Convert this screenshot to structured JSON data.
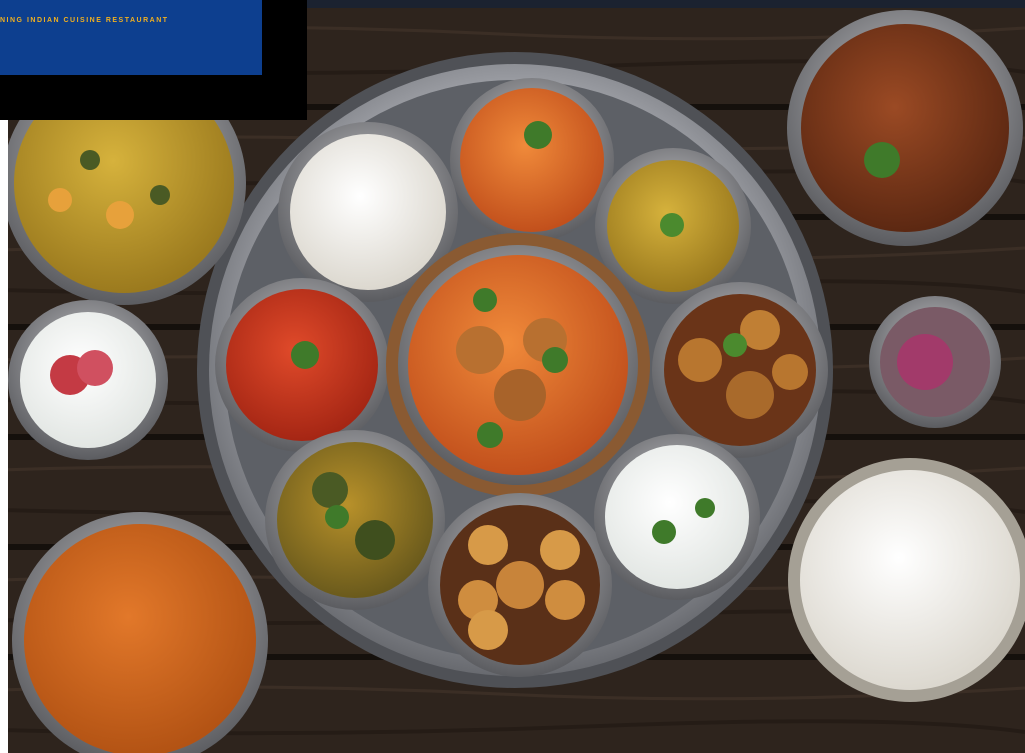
{
  "banner": {
    "text": "NING INDIAN CUISINE RESTAURANT"
  },
  "scene": {
    "image_alt": "Overhead view of an Indian thali platter with curries, rice, raita and side bowls on a dark wooden table",
    "colors": {
      "wood": "#2b221c",
      "steel": "#8f8f95",
      "banner": "#0d3f8f",
      "banner_text": "#f0b020"
    }
  }
}
